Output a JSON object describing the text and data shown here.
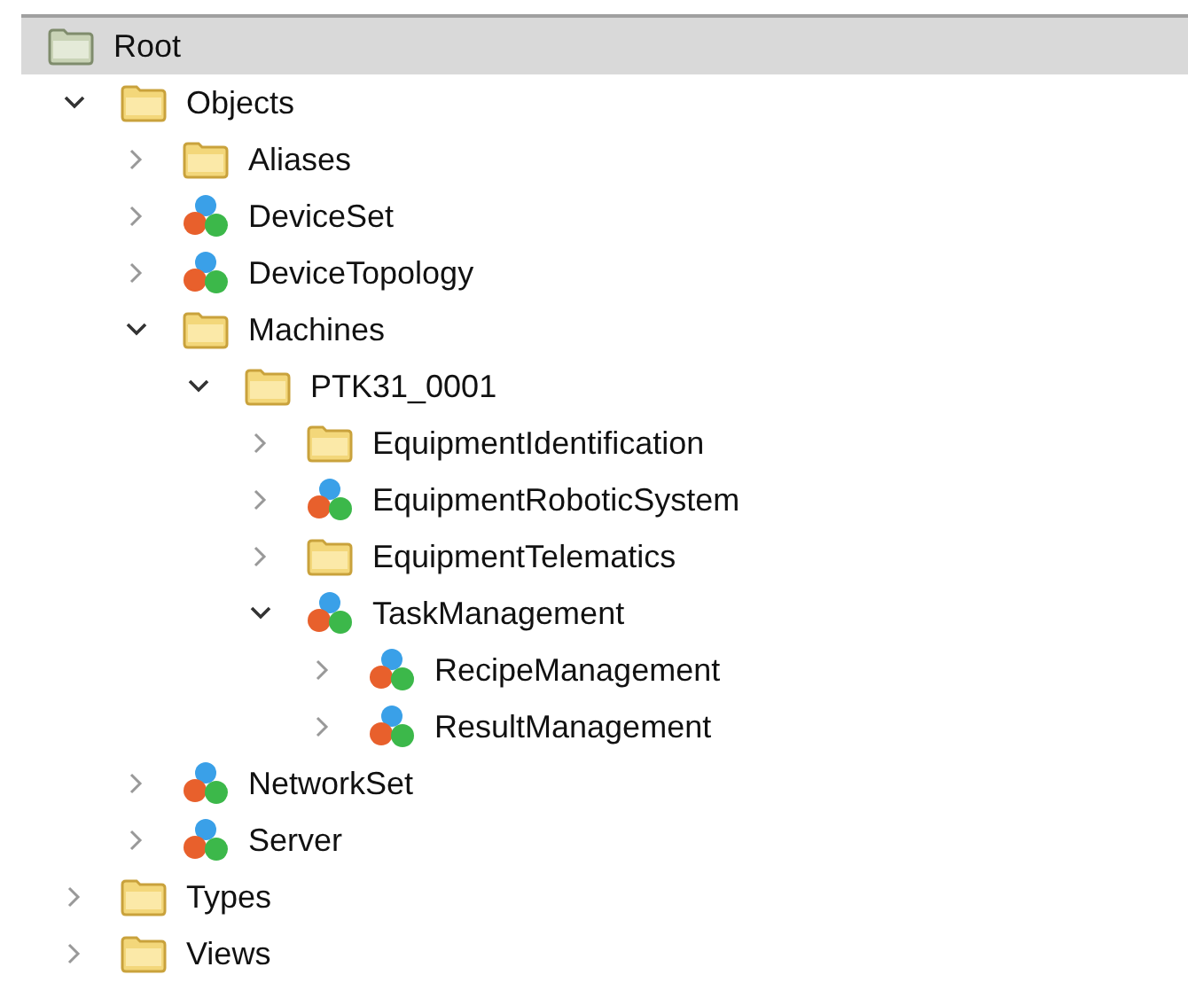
{
  "tree": [
    {
      "label": "Root",
      "kind": "root",
      "selected": true,
      "children": [
        {
          "label": "Objects",
          "kind": "folder",
          "selected": false,
          "expanded": true,
          "children": [
            {
              "label": "Aliases",
              "kind": "folder",
              "selected": false,
              "expanded": false
            },
            {
              "label": "DeviceSet",
              "kind": "object",
              "selected": false,
              "expanded": false
            },
            {
              "label": "DeviceTopology",
              "kind": "object",
              "selected": false,
              "expanded": false
            },
            {
              "label": "Machines",
              "kind": "folder",
              "selected": false,
              "expanded": true,
              "children": [
                {
                  "label": "PTK31_0001",
                  "kind": "folder",
                  "selected": false,
                  "expanded": true,
                  "children": [
                    {
                      "label": "EquipmentIdentification",
                      "kind": "folder",
                      "selected": false,
                      "expanded": false
                    },
                    {
                      "label": "EquipmentRoboticSystem",
                      "kind": "object",
                      "selected": false,
                      "expanded": false
                    },
                    {
                      "label": "EquipmentTelematics",
                      "kind": "folder",
                      "selected": false,
                      "expanded": false
                    },
                    {
                      "label": "TaskManagement",
                      "kind": "object",
                      "selected": false,
                      "expanded": true,
                      "children": [
                        {
                          "label": "RecipeManagement",
                          "kind": "object",
                          "selected": false,
                          "expanded": false
                        },
                        {
                          "label": "ResultManagement",
                          "kind": "object",
                          "selected": false,
                          "expanded": false
                        }
                      ]
                    }
                  ]
                }
              ]
            },
            {
              "label": "NetworkSet",
              "kind": "object",
              "selected": false,
              "expanded": false
            },
            {
              "label": "Server",
              "kind": "object",
              "selected": false,
              "expanded": false
            }
          ]
        },
        {
          "label": "Types",
          "kind": "folder",
          "selected": false,
          "expanded": false
        },
        {
          "label": "Views",
          "kind": "folder",
          "selected": false,
          "expanded": false
        }
      ]
    }
  ]
}
